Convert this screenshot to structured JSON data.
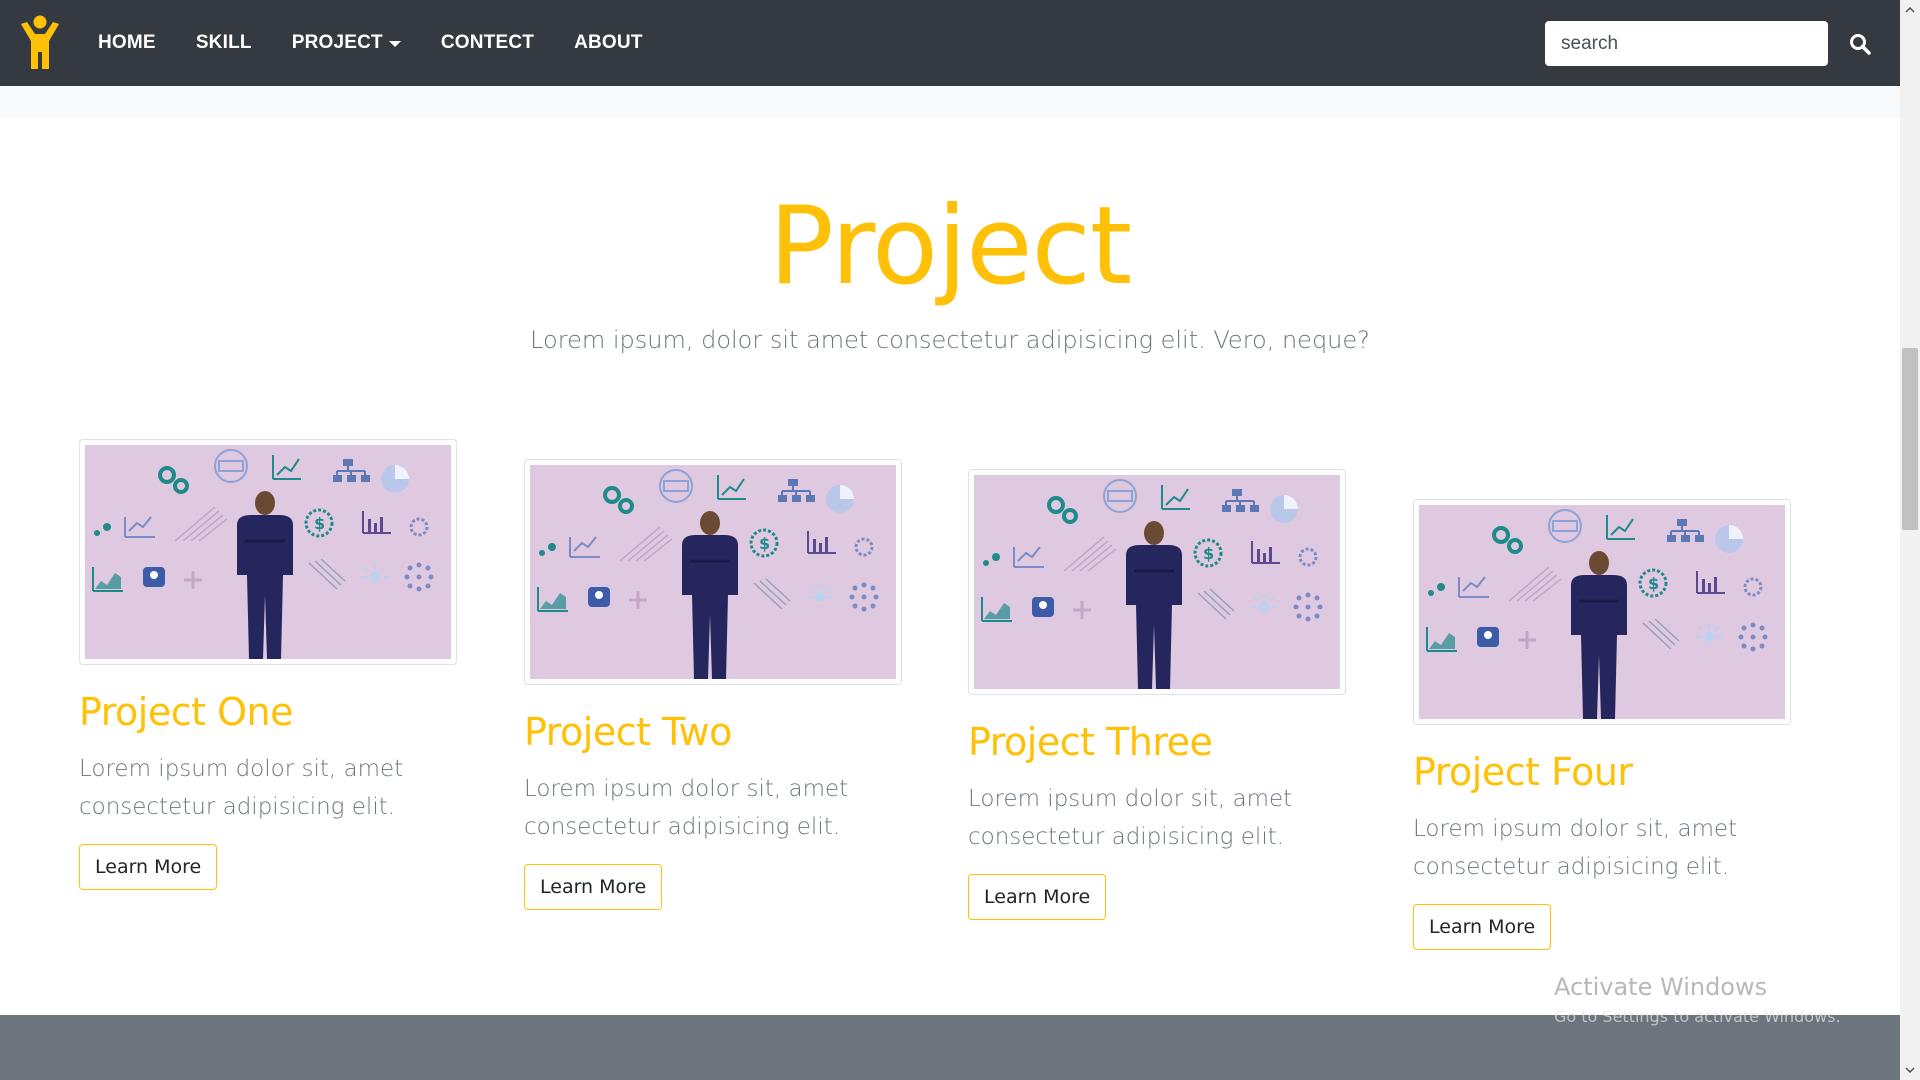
{
  "nav": {
    "items": [
      {
        "label": "HOME"
      },
      {
        "label": "SKILL"
      },
      {
        "label": "PROJECT",
        "has_dropdown": true
      },
      {
        "label": "CONTECT"
      },
      {
        "label": "ABOUT"
      }
    ],
    "search_placeholder": "search",
    "brand_icon": "person-arms-up-icon",
    "search_icon": "search-icon"
  },
  "section": {
    "title": "Project",
    "subtitle": "Lorem ipsum, dolor sit amet consectetur adipisicing elit. Vero, neque?"
  },
  "cards": [
    {
      "title": "Project One",
      "text": "Lorem ipsum dolor sit, amet consectetur adipisicing elit.",
      "button": "Learn More"
    },
    {
      "title": "Project Two",
      "text": "Lorem ipsum dolor sit, amet consectetur adipisicing elit.",
      "button": "Learn More"
    },
    {
      "title": "Project Three",
      "text": "Lorem ipsum dolor sit, amet consectetur adipisicing elit.",
      "button": "Learn More"
    },
    {
      "title": "Project Four",
      "text": "Lorem ipsum dolor sit, amet consectetur adipisicing elit.",
      "button": "Learn More"
    }
  ],
  "watermark": {
    "title": "Activate Windows",
    "subtitle": "Go to Settings to activate Windows."
  },
  "colors": {
    "navbar": "#343a40",
    "accent": "#ffc107",
    "muted_text": "#6c757d",
    "footer": "#6c757d",
    "illustration_bg": "#dfc9e0"
  }
}
